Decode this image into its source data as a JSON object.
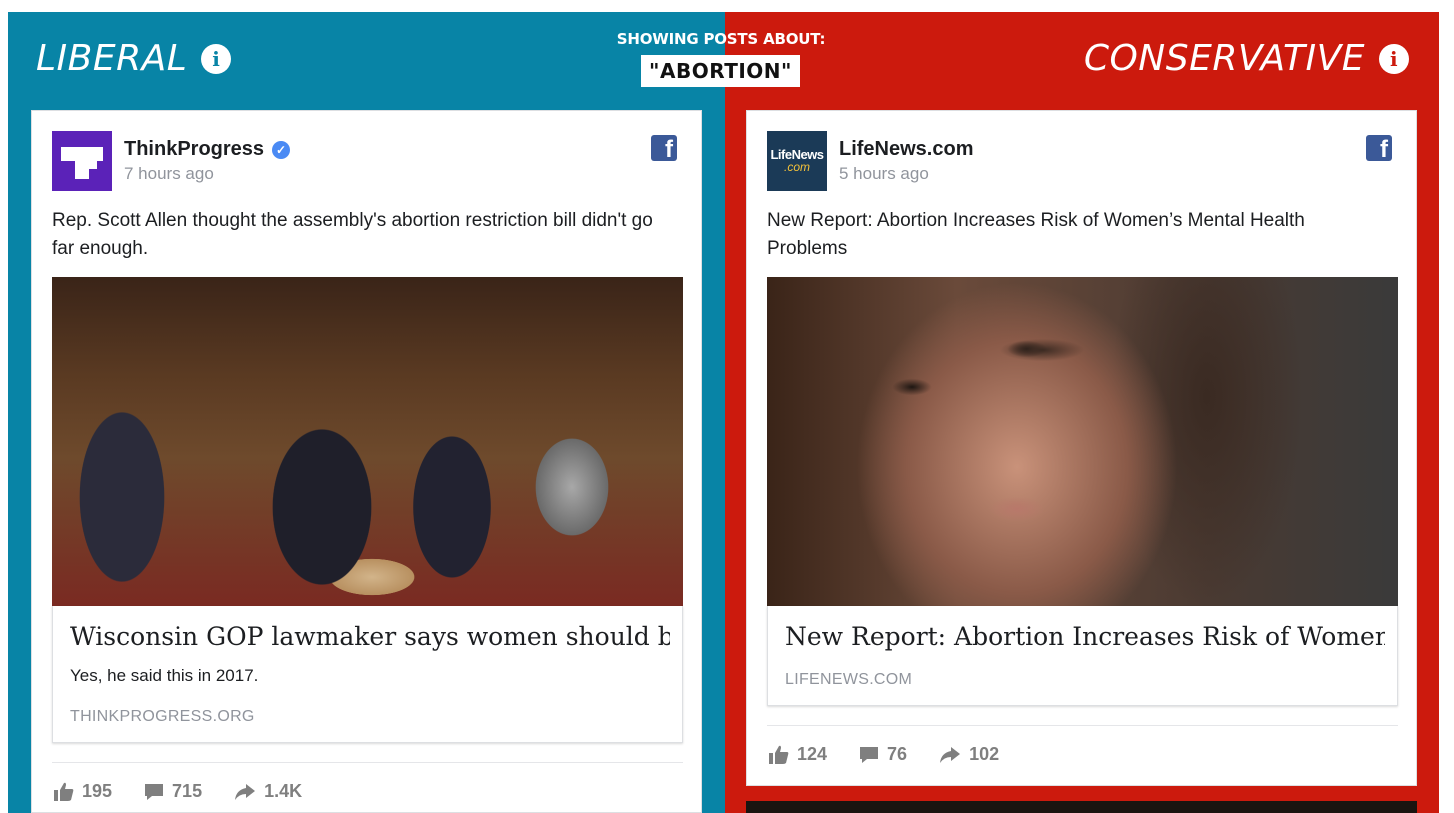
{
  "topic_bar": {
    "label": "SHOWING POSTS ABOUT:",
    "topic": "\"ABORTION\""
  },
  "colors": {
    "liberal": "#0884a6",
    "conservative": "#cc1a0d",
    "facebook": "#3b5998"
  },
  "liberal": {
    "heading": "LIBERAL",
    "info_icon": "info-icon",
    "post": {
      "page_name": "ThinkProgress",
      "verified_icon": "verified-check-icon",
      "timestamp": "7 hours ago",
      "text": "Rep. Scott Allen thought the assembly's abortion restriction bill didn't go far enough.",
      "image_alt": "Legislators shaking hands in assembly chamber",
      "link_title": "Wisconsin GOP lawmaker says women should b...",
      "link_description": "Yes, he said this in 2017.",
      "link_domain": "THINKPROGRESS.ORG",
      "likes": "195",
      "comments": "715",
      "shares": "1.4K"
    }
  },
  "conservative": {
    "heading": "CONSERVATIVE",
    "info_icon": "info-icon",
    "post": {
      "page_name": "LifeNews.com",
      "avatar_text_1": "LifeNews",
      "avatar_text_2": ".com",
      "timestamp": "5 hours ago",
      "text": "New Report: Abortion Increases Risk of Women’s Mental Health Problems",
      "image_alt": "Close-up portrait of a woman",
      "link_title": "New Report: Abortion Increases Risk of Women...",
      "link_domain": "LIFENEWS.COM",
      "likes": "124",
      "comments": "76",
      "shares": "102"
    }
  }
}
